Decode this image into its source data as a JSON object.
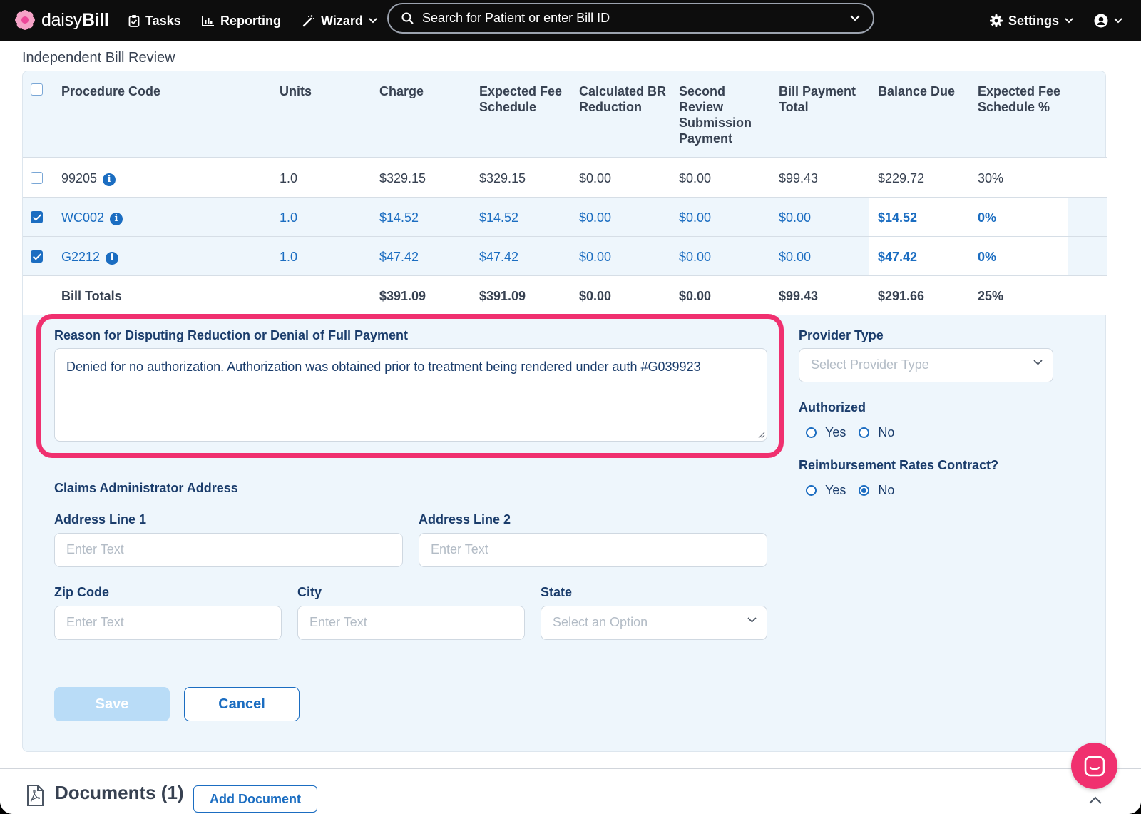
{
  "app": {
    "brand_light": "daisy",
    "brand_bold": "Bill"
  },
  "nav": {
    "tasks": "Tasks",
    "reporting": "Reporting",
    "wizard": "Wizard",
    "search_placeholder": "Search for Patient or enter Bill ID",
    "settings": "Settings"
  },
  "section": {
    "title": "Independent Bill Review"
  },
  "table": {
    "headers": {
      "procedure_code": "Procedure Code",
      "units": "Units",
      "charge": "Charge",
      "expected_fee_schedule": "Expected Fee Schedule",
      "calculated_br_reduction": "Calculated BR Reduction",
      "second_review_submission_payment": "Second Review Submission Payment",
      "bill_payment_total": "Bill Payment Total",
      "balance_due": "Balance Due",
      "expected_fee_schedule_pct": "Expected Fee Schedule %"
    },
    "rows": [
      {
        "checked": false,
        "code": "99205",
        "units": "1.0",
        "charge": "$329.15",
        "expected_fee": "$329.15",
        "br_reduction": "$0.00",
        "second_review": "$0.00",
        "bill_payment_total": "$99.43",
        "balance_due": "$229.72",
        "pct": "30%"
      },
      {
        "checked": true,
        "code": "WC002",
        "units": "1.0",
        "charge": "$14.52",
        "expected_fee": "$14.52",
        "br_reduction": "$0.00",
        "second_review": "$0.00",
        "bill_payment_total": "$0.00",
        "balance_due": "$14.52",
        "pct": "0%"
      },
      {
        "checked": true,
        "code": "G2212",
        "units": "1.0",
        "charge": "$47.42",
        "expected_fee": "$47.42",
        "br_reduction": "$0.00",
        "second_review": "$0.00",
        "bill_payment_total": "$0.00",
        "balance_due": "$47.42",
        "pct": "0%"
      }
    ],
    "totals": {
      "label": "Bill Totals",
      "charge": "$391.09",
      "expected_fee": "$391.09",
      "br_reduction": "$0.00",
      "second_review": "$0.00",
      "bill_payment_total": "$99.43",
      "balance_due": "$291.66",
      "pct": "25%"
    }
  },
  "form": {
    "reason_label": "Reason for Disputing Reduction or Denial of Full Payment",
    "reason_value": "Denied for no authorization. Authorization was obtained prior to treatment being rendered under auth #G039923",
    "provider_type_label": "Provider Type",
    "provider_type_placeholder": "Select Provider Type",
    "authorized_label": "Authorized",
    "authorized_yes": "Yes",
    "authorized_no": "No",
    "authorized_value": null,
    "rates_label": "Reimbursement Rates Contract?",
    "rates_yes": "Yes",
    "rates_no": "No",
    "rates_value": "No",
    "claims_admin_label": "Claims Administrator Address",
    "address1_label": "Address Line 1",
    "address2_label": "Address Line 2",
    "zip_label": "Zip Code",
    "city_label": "City",
    "state_label": "State",
    "text_placeholder": "Enter Text",
    "state_placeholder": "Select an Option",
    "save": "Save",
    "cancel": "Cancel"
  },
  "documents": {
    "title": "Documents (1)",
    "add": "Add Document"
  },
  "colors": {
    "accent": "#1b6dc1",
    "highlight": "#f0306f",
    "panel": "#eef6fc",
    "nav": "#0d0d0d"
  }
}
